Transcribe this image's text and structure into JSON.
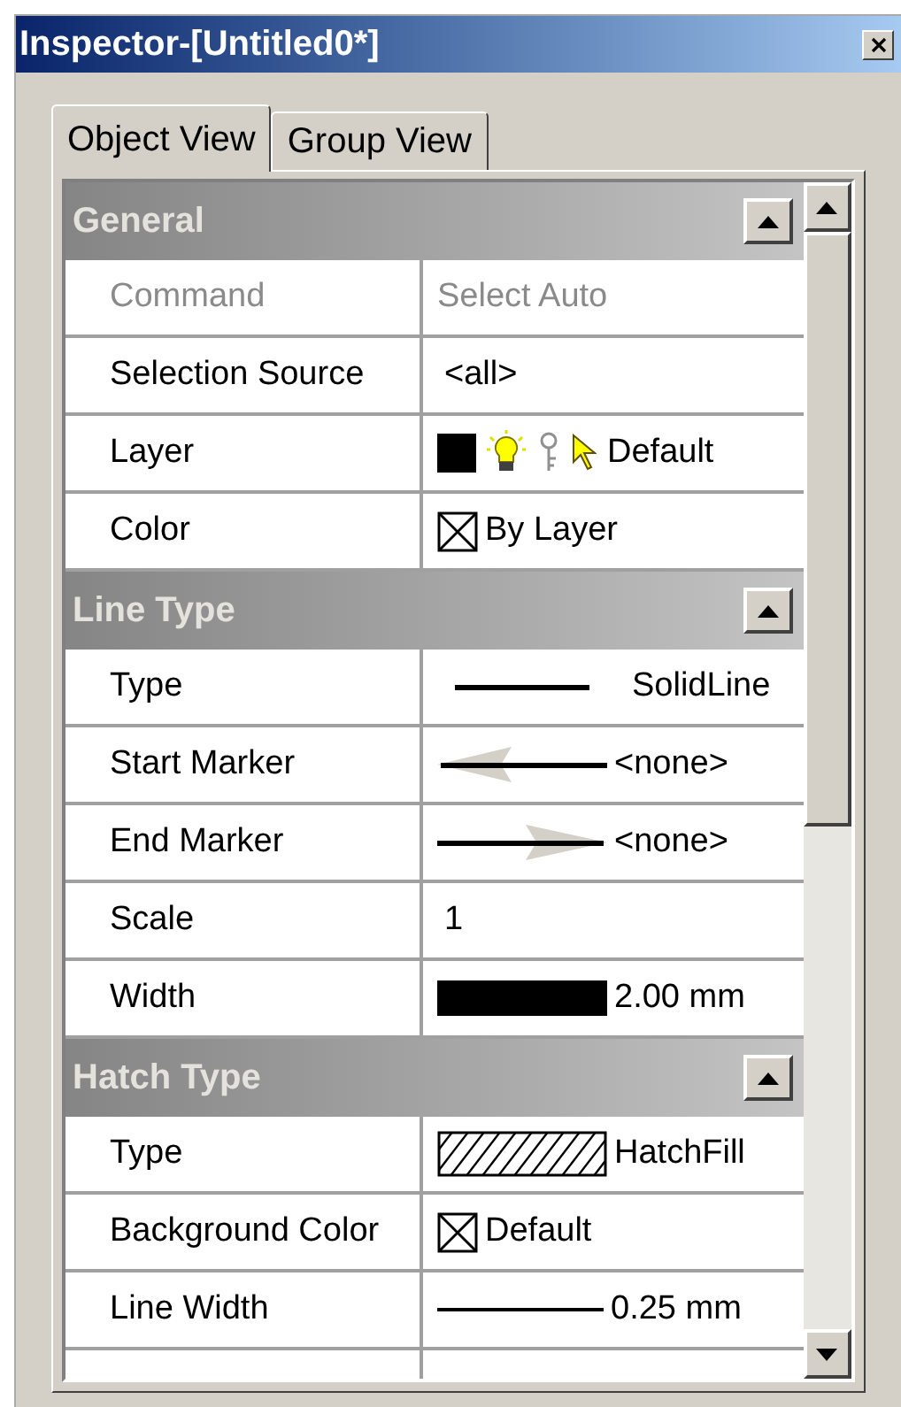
{
  "window": {
    "title": "Inspector-[Untitled0*]"
  },
  "tabs": [
    {
      "label": "Object View",
      "selected": true
    },
    {
      "label": "Group View",
      "selected": false
    }
  ],
  "sections": [
    {
      "title": "General",
      "expanded": true,
      "rows": [
        {
          "label": "Command",
          "value": "Select Auto",
          "kind": "text",
          "disabled": true
        },
        {
          "label": "Selection Source",
          "value": "<all>",
          "kind": "text",
          "disabled": false
        },
        {
          "label": "Layer",
          "value": "Default",
          "kind": "layer",
          "disabled": false
        },
        {
          "label": "Color",
          "value": "By Layer",
          "kind": "nocolor",
          "disabled": false
        }
      ]
    },
    {
      "title": "Line Type",
      "expanded": true,
      "rows": [
        {
          "label": "Type",
          "value": "SolidLine",
          "kind": "line",
          "disabled": false
        },
        {
          "label": "Start Marker",
          "value": "<none>",
          "kind": "start-marker",
          "disabled": false
        },
        {
          "label": "End Marker",
          "value": "<none>",
          "kind": "end-marker",
          "disabled": false
        },
        {
          "label": "Scale",
          "value": "1",
          "kind": "text",
          "disabled": false
        },
        {
          "label": "Width",
          "value": "2.00 mm",
          "kind": "width",
          "disabled": false
        }
      ]
    },
    {
      "title": "Hatch Type",
      "expanded": true,
      "rows": [
        {
          "label": "Type",
          "value": "HatchFill",
          "kind": "hatch",
          "disabled": false
        },
        {
          "label": "Background Color",
          "value": "Default",
          "kind": "nocolor",
          "disabled": false
        },
        {
          "label": "Line Width",
          "value": "0.25 mm",
          "kind": "thin-line",
          "disabled": false
        }
      ]
    }
  ]
}
